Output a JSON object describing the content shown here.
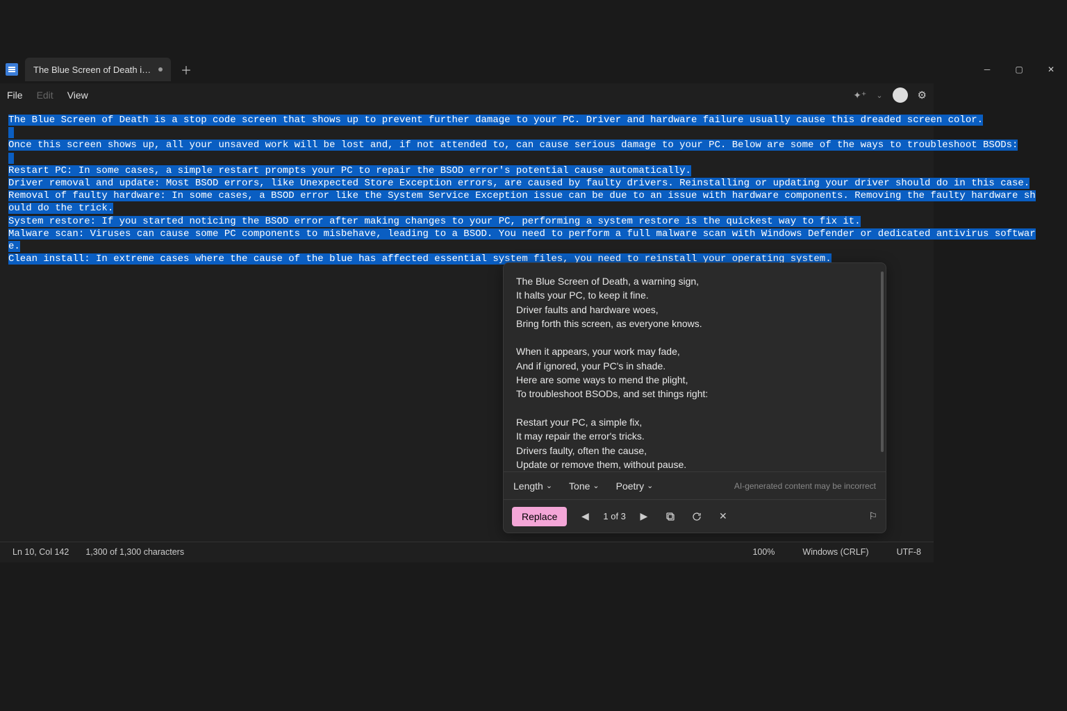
{
  "tab": {
    "title": "The Blue Screen of Death is a stop"
  },
  "menu": {
    "file": "File",
    "edit": "Edit",
    "view": "View"
  },
  "doc_lines": [
    "The Blue Screen of Death is a stop code screen that shows up to prevent further damage to your PC. Driver and hardware failure usually cause this dreaded screen color.",
    "",
    "Once this screen shows up, all your unsaved work will be lost and, if not attended to, can cause serious damage to your PC. Below are some of the ways to troubleshoot BSODs:",
    "",
    "Restart PC: In some cases, a simple restart prompts your PC to repair the BSOD error's potential cause automatically.",
    "Driver removal and update: Most BSOD errors, like Unexpected Store Exception errors, are caused by faulty drivers. Reinstalling or updating your driver should do in this case.",
    "Removal of faulty hardware: In some cases, a BSOD error like the System Service Exception issue can be due to an issue with hardware components. Removing the faulty hardware should do the trick.",
    "System restore: If you started noticing the BSOD error after making changes to your PC, performing a system restore is the quickest way to fix it.",
    "Malware scan: Viruses can cause some PC components to misbehave, leading to a BSOD. You need to perform a full malware scan with Windows Defender or dedicated antivirus software.",
    "Clean install: In extreme cases where the cause of the blue has affected essential system files, you need to reinstall your operating system."
  ],
  "ai": {
    "poem": "The Blue Screen of Death, a warning sign,\nIt halts your PC, to keep it fine.\nDriver faults and hardware woes,\nBring forth this screen, as everyone knows.\n\nWhen it appears, your work may fade,\nAnd if ignored, your PC's in shade.\nHere are some ways to mend the plight,\nTo troubleshoot BSODs, and set things right:\n\nRestart your PC, a simple fix,\nIt may repair the error's tricks.\nDrivers faulty, often the cause,\nUpdate or remove them, without pause.\n\nFaulty hardware can lead to despair,\nRemove the culprit, show it the air.\nIf changes made brought this blue hue,",
    "dd_length": "Length",
    "dd_tone": "Tone",
    "dd_poetry": "Poetry",
    "disclaimer": "AI-generated content may be incorrect",
    "replace": "Replace",
    "pager": "1 of 3"
  },
  "status": {
    "pos": "Ln 10, Col 142",
    "sel": "1,300 of 1,300 characters",
    "zoom": "100%",
    "eol": "Windows (CRLF)",
    "enc": "UTF-8"
  }
}
